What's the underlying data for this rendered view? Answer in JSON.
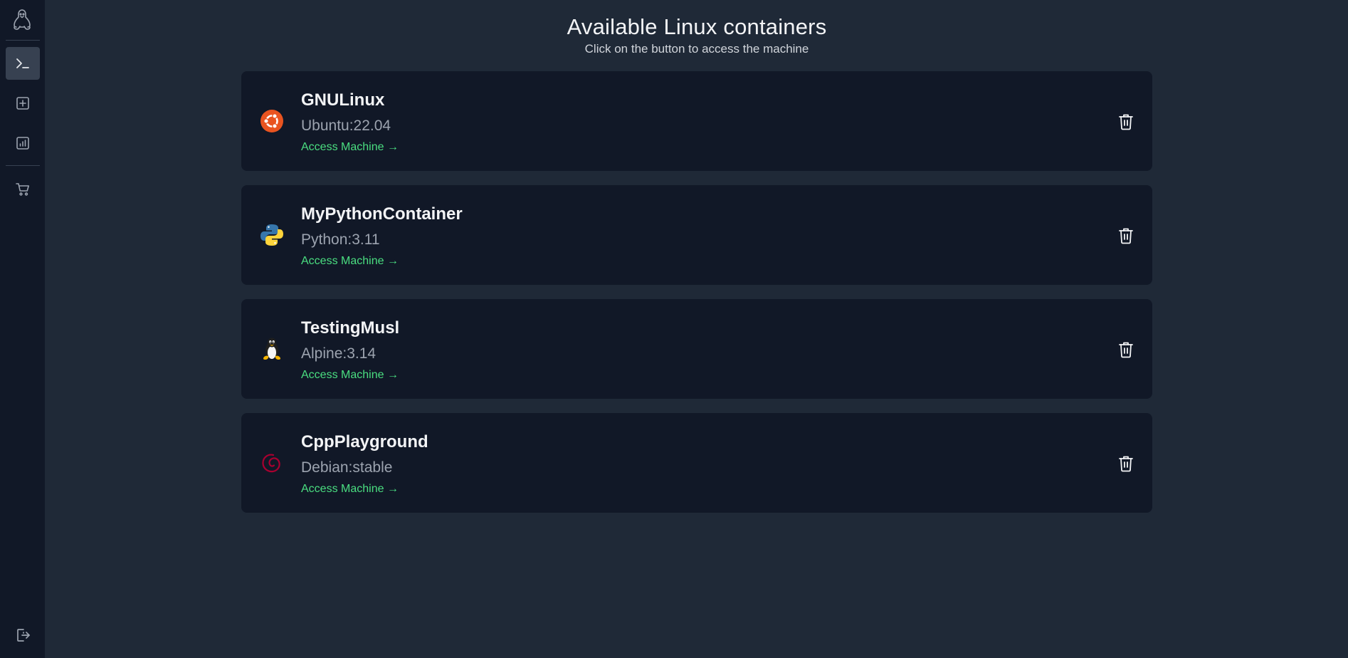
{
  "page": {
    "title": "Available Linux containers",
    "subtitle": "Click on the button to access the machine"
  },
  "sidebar": {
    "items": [
      {
        "name": "terminal",
        "icon": "terminal-icon",
        "active": true
      },
      {
        "name": "add",
        "icon": "plus-square-icon",
        "active": false
      },
      {
        "name": "stats",
        "icon": "bar-chart-icon",
        "active": false
      },
      {
        "name": "store",
        "icon": "cart-icon",
        "active": false
      },
      {
        "name": "logout",
        "icon": "logout-icon",
        "active": false
      }
    ]
  },
  "containers": [
    {
      "name": "GNULinux",
      "image": "Ubuntu:22.04",
      "link": "Access Machine →",
      "logo": "ubuntu-logo-icon"
    },
    {
      "name": "MyPythonContainer",
      "image": "Python:3.11",
      "link": "Access Machine →",
      "logo": "python-logo-icon"
    },
    {
      "name": "TestingMusl",
      "image": "Alpine:3.14",
      "link": "Access Machine →",
      "logo": "tux-logo-icon"
    },
    {
      "name": "CppPlayground",
      "image": "Debian:stable",
      "link": "Access Machine →",
      "logo": "debian-logo-icon"
    }
  ],
  "colors": {
    "background": "#1f2937",
    "card": "#111827",
    "accent": "#4ade80",
    "ubuntu": "#e95420",
    "debian": "#a80030"
  }
}
